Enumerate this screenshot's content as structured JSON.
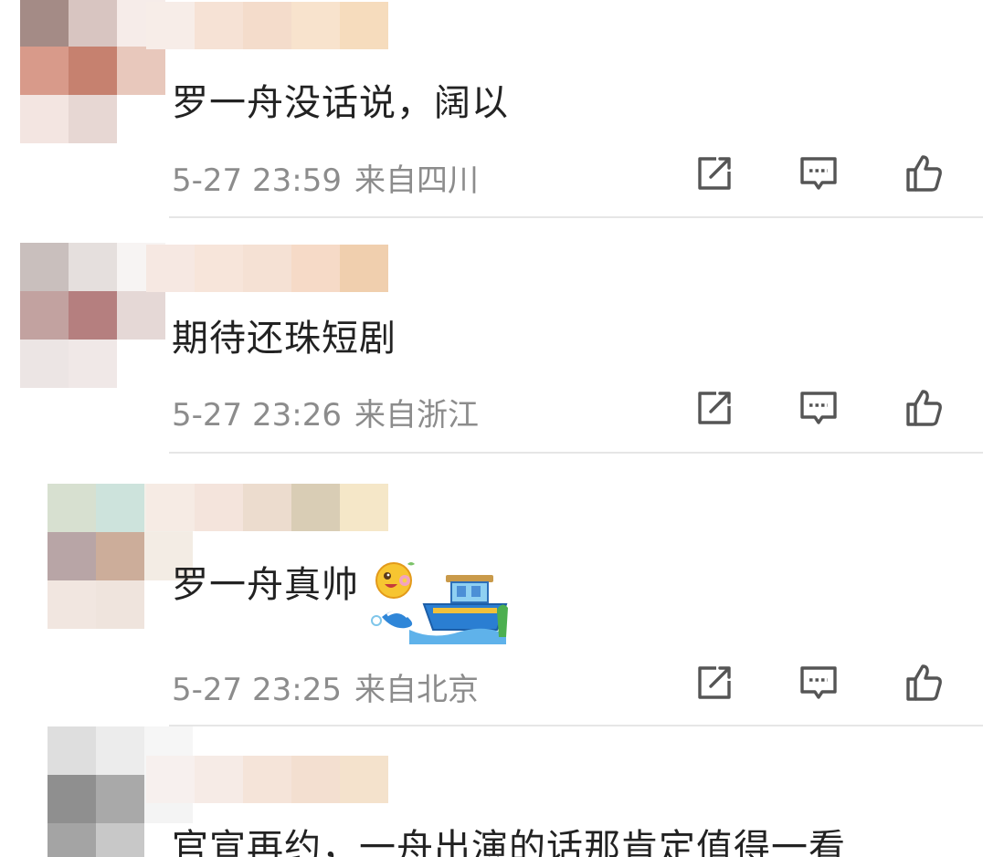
{
  "comments": [
    {
      "text": "罗一舟没话说，阔以",
      "time": "5-27 23:59",
      "location": "来自四川",
      "avatar_colors": [
        "#a48b86",
        "#d8c5c1",
        "#f6ece9",
        "#d89a8a",
        "#c6816f",
        "#e8c8bc",
        "#f3e5e1",
        "#e7d7d3",
        "#ffffff"
      ],
      "name_colors": [
        "#f7ede8",
        "#f6e2d5",
        "#f4dccb",
        "#f8e3cd",
        "#f6dcbd"
      ]
    },
    {
      "text": "期待还珠短剧",
      "time": "5-27 23:26",
      "location": "来自浙江",
      "avatar_colors": [
        "#c9bfbd",
        "#e5dfdd",
        "#f7f4f3",
        "#c2a2a0",
        "#b57f7f",
        "#e5d8d6",
        "#ece5e4",
        "#f0e8e7",
        "#ffffff"
      ],
      "name_colors": [
        "#f6e8e2",
        "#f7e5da",
        "#f5e1d4",
        "#f6dac7",
        "#f0cfae"
      ]
    },
    {
      "text": "罗一舟真帅",
      "time": "5-27 23:25",
      "location": "来自北京",
      "avatar_colors": [
        "#d7e0d0",
        "#cde3dc",
        "#f3efe8",
        "#b8a5a6",
        "#ccad9a",
        "#f3ece4",
        "#f1e6e0",
        "#efe4dd",
        "#ffffff"
      ],
      "name_colors": [
        "#f6ebe4",
        "#f4e4dc",
        "#ecdcce",
        "#d9cdb5",
        "#f5e7c8"
      ]
    },
    {
      "text": "官宣再约，一舟出演的话那肯定值得一看",
      "avatar_colors": [
        "#dedede",
        "#ececec",
        "#f6f6f6",
        "#8f8f8f",
        "#a9a9a9",
        "#f4f4f4",
        "#a4a4a4",
        "#c8c8c8",
        "#ffffff"
      ],
      "name_colors": [
        "#f7f0ee",
        "#f6ebe6",
        "#f5e4d9",
        "#f3dfd0",
        "#f4e2cc"
      ]
    }
  ],
  "icons": {
    "share": "share-icon",
    "comment": "comment-icon",
    "like": "thumbs-up-icon"
  },
  "colors": {
    "text": "#222222",
    "meta": "#8c8c8c",
    "icon": "#555555",
    "divider": "#e6e6e6"
  }
}
